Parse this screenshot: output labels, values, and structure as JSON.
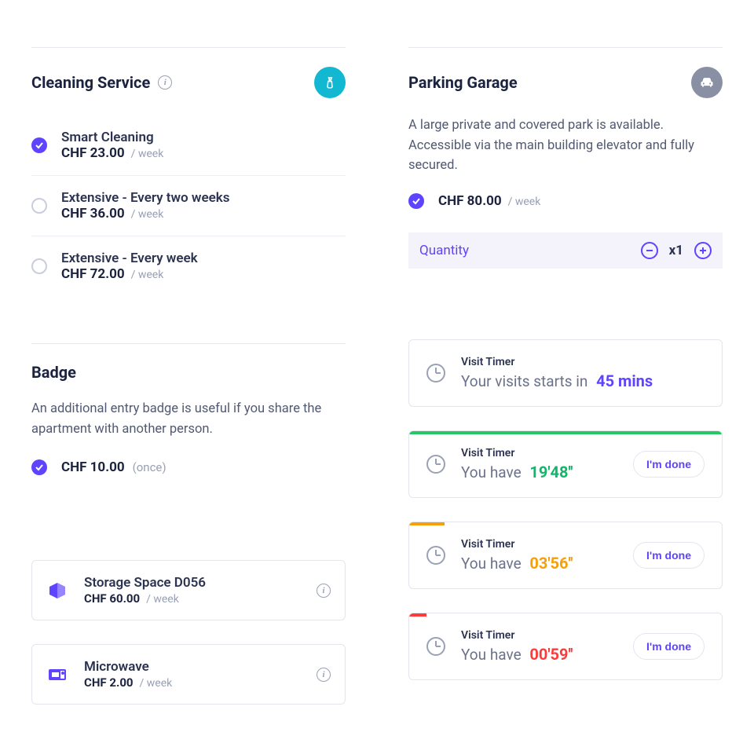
{
  "cleaning": {
    "title": "Cleaning Service",
    "options": [
      {
        "title": "Smart Cleaning",
        "price": "CHF 23.00",
        "period": "/ week",
        "checked": true
      },
      {
        "title": "Extensive - Every two weeks",
        "price": "CHF 36.00",
        "period": "/ week",
        "checked": false
      },
      {
        "title": "Extensive - Every week",
        "price": "CHF 72.00",
        "period": "/ week",
        "checked": false
      }
    ]
  },
  "badge": {
    "title": "Badge",
    "desc": "An additional entry badge is useful if you share the apartment with another person.",
    "price": "CHF 10.00",
    "note": "(once)"
  },
  "cards": [
    {
      "title": "Storage Space D056",
      "price": "CHF 60.00",
      "period": "/ week"
    },
    {
      "title": "Microwave",
      "price": "CHF 2.00",
      "period": "/ week"
    }
  ],
  "parking": {
    "title": "Parking Garage",
    "desc": "A large private and covered park is available. Accessible via the main building elevator and fully secured.",
    "price": "CHF 80.00",
    "period": "/ week",
    "qtyLabel": "Quantity",
    "qty": "x1"
  },
  "timers": {
    "label": "Visit Timer",
    "startsPrefix": "Your visits starts in",
    "starts": "45 mins",
    "havePrefix": "You have",
    "doneLabel": "I'm done",
    "items": [
      {
        "value": "19'48''",
        "color": "green"
      },
      {
        "value": "03'56''",
        "color": "orange"
      },
      {
        "value": "00'59''",
        "color": "red"
      }
    ]
  }
}
